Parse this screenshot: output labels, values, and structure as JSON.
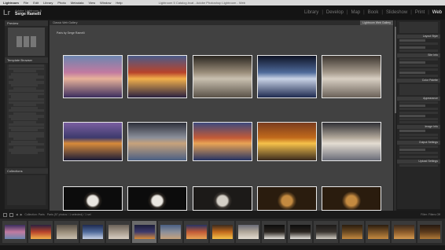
{
  "menubar": {
    "items": [
      "Lightroom",
      "File",
      "Edit",
      "Library",
      "Photo",
      "Metadata",
      "View",
      "Window",
      "Help"
    ],
    "title": "Lightroom 5 Catalog.lrcat - Adobe Photoshop Lightroom - Web"
  },
  "identity": {
    "top": "Adobe Lightroom 5",
    "name": "Serge Ramelli"
  },
  "modules": {
    "library": "Library",
    "develop": "Develop",
    "map": "Map",
    "book": "Book",
    "slideshow": "Slideshow",
    "print": "Print",
    "web": "Web",
    "sep": "|"
  },
  "left_panel": {
    "preview": "Preview",
    "template_browser": "Template Browser",
    "collections": "Collections"
  },
  "center": {
    "tab": "Classic Web Gallery",
    "tab_right": "Lightroom Web Gallery",
    "crumb": "Paris by Serge Ramelli"
  },
  "right_panel": {
    "sections": [
      "Layout Style",
      "Site Info",
      "Color Palette",
      "Appearance",
      "Image Info",
      "Output Settings",
      "Upload Settings"
    ]
  },
  "filmstrip_bar": {
    "label": "Collection: Paris",
    "count": "Paris (57 photos / 1 selected) / 1 sel",
    "filter": "Filter:",
    "filter_value": "Filters Off"
  },
  "photos_row1": [
    {
      "palette": [
        "#3b2d5e",
        "#c27aa0",
        "#e7b29a",
        "#6c86b0"
      ]
    },
    {
      "palette": [
        "#2a2140",
        "#b8432b",
        "#f2b04c",
        "#4a5c8a"
      ]
    },
    {
      "palette": [
        "#5a5248",
        "#9a8d7a",
        "#c9c0b0",
        "#2a2620"
      ]
    },
    {
      "palette": [
        "#1e2a50",
        "#4f6a9a",
        "#c9d3e6",
        "#0e1325"
      ]
    },
    {
      "palette": [
        "#6b6259",
        "#a59a8c",
        "#d8cfc3",
        "#3c352f"
      ]
    }
  ],
  "photos_row2": [
    {
      "palette": [
        "#1b1c38",
        "#3d3a6c",
        "#d88b3a",
        "#7a5fa0"
      ]
    },
    {
      "palette": [
        "#4a5f84",
        "#8b8f9a",
        "#c7a27b",
        "#2d2f3a"
      ]
    },
    {
      "palette": [
        "#263364",
        "#c25a37",
        "#e9a455",
        "#3e4a7e"
      ]
    },
    {
      "palette": [
        "#3a2a1e",
        "#c26a1c",
        "#f6c24a",
        "#7a3c1e"
      ]
    },
    {
      "palette": [
        "#6a6c78",
        "#b2a89a",
        "#e4ddd2",
        "#2f2f35"
      ]
    }
  ],
  "photos_row3": [
    {
      "palette": [
        "#0c0c0c",
        "#2a2520",
        "#e9e6e0"
      ]
    },
    {
      "palette": [
        "#0c0c0c",
        "#2a2520",
        "#e9e6e0"
      ]
    },
    {
      "palette": [
        "#1c1a18",
        "#3a3530",
        "#d4cfc6"
      ]
    },
    {
      "palette": [
        "#2a1c0e",
        "#6b4a22",
        "#c48a40"
      ]
    },
    {
      "palette": [
        "#2a1c0e",
        "#7a5428",
        "#c48a40"
      ]
    }
  ],
  "filmstrip": [
    {
      "palette": [
        "#3b2d5e",
        "#c27aa0",
        "#6c86b0"
      ]
    },
    {
      "palette": [
        "#2a2140",
        "#b8432b",
        "#f2b04c"
      ]
    },
    {
      "palette": [
        "#5a5248",
        "#9a8d7a",
        "#c9c0b0"
      ]
    },
    {
      "palette": [
        "#1e2a50",
        "#4f6a9a",
        "#c9d3e6"
      ]
    },
    {
      "palette": [
        "#6b6259",
        "#a59a8c",
        "#d8cfc3"
      ]
    },
    {
      "palette": [
        "#1b1c38",
        "#3d3a6c",
        "#d88b3a"
      ]
    },
    {
      "palette": [
        "#4a5f84",
        "#8b8f9a",
        "#c7a27b"
      ]
    },
    {
      "palette": [
        "#263364",
        "#c25a37",
        "#e9a455"
      ]
    },
    {
      "palette": [
        "#3a2a1e",
        "#c26a1c",
        "#f6c24a"
      ]
    },
    {
      "palette": [
        "#6a6c78",
        "#b2a89a",
        "#e4ddd2"
      ]
    },
    {
      "palette": [
        "#0c0c0c",
        "#2a2520",
        "#e9e6e0"
      ]
    },
    {
      "palette": [
        "#0c0c0c",
        "#2a2520",
        "#e9e6e0"
      ]
    },
    {
      "palette": [
        "#1c1a18",
        "#3a3530",
        "#d4cfc6"
      ]
    },
    {
      "palette": [
        "#2a1c0e",
        "#6b4a22",
        "#c48a40"
      ]
    },
    {
      "palette": [
        "#2a1c0e",
        "#7a5428",
        "#c48a40"
      ]
    },
    {
      "palette": [
        "#3a2a1e",
        "#8a5a2a",
        "#d49a50"
      ]
    },
    {
      "palette": [
        "#241810",
        "#5a3a1c",
        "#b07a38"
      ]
    }
  ],
  "colors": {
    "accent": "#ffffff",
    "panel": "#262626",
    "gallery": "#414141"
  }
}
